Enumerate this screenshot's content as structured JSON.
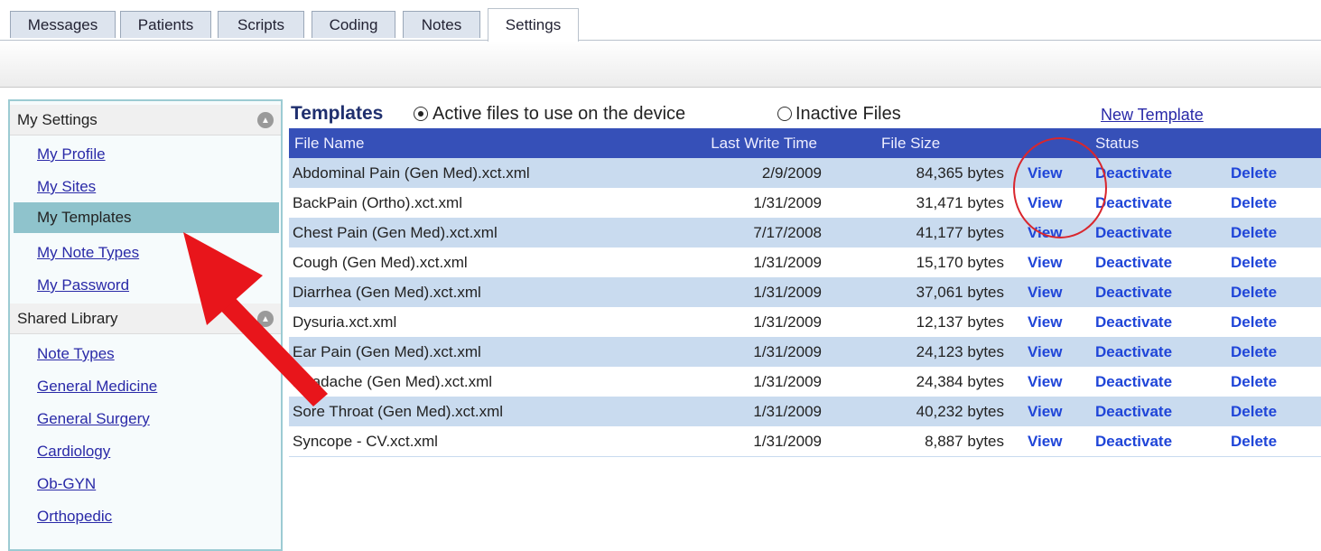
{
  "tabs": [
    {
      "label": "Messages"
    },
    {
      "label": "Patients"
    },
    {
      "label": "Scripts"
    },
    {
      "label": "Coding"
    },
    {
      "label": "Notes"
    },
    {
      "label": "Settings",
      "active": true
    }
  ],
  "sidebar": {
    "my_settings": {
      "title": "My Settings",
      "items": [
        {
          "label": "My Profile"
        },
        {
          "label": "My Sites"
        },
        {
          "label": "My Templates",
          "selected": true
        },
        {
          "label": "My Note Types"
        },
        {
          "label": "My Password"
        }
      ]
    },
    "shared_library": {
      "title": "Shared Library",
      "items": [
        {
          "label": "Note Types"
        },
        {
          "label": "General Medicine"
        },
        {
          "label": "General  Surgery"
        },
        {
          "label": "Cardiology"
        },
        {
          "label": "Ob-GYN"
        },
        {
          "label": "Orthopedic"
        }
      ]
    }
  },
  "main": {
    "title": "Templates",
    "radio_active": "Active files to use on the device",
    "radio_inactive": "Inactive Files",
    "new_template": "New Template",
    "columns": {
      "name": "File Name",
      "date": "Last Write Time",
      "size": "File Size",
      "status": "Status"
    },
    "actions": {
      "view": "View",
      "deactivate": "Deactivate",
      "delete": "Delete"
    },
    "rows": [
      {
        "name": "Abdominal Pain (Gen Med).xct.xml",
        "date": "2/9/2009",
        "size": "84,365 bytes"
      },
      {
        "name": "BackPain (Ortho).xct.xml",
        "date": "1/31/2009",
        "size": "31,471 bytes"
      },
      {
        "name": "Chest Pain (Gen Med).xct.xml",
        "date": "7/17/2008",
        "size": "41,177 bytes"
      },
      {
        "name": "Cough (Gen Med).xct.xml",
        "date": "1/31/2009",
        "size": "15,170 bytes"
      },
      {
        "name": "Diarrhea (Gen Med).xct.xml",
        "date": "1/31/2009",
        "size": "37,061 bytes"
      },
      {
        "name": "Dysuria.xct.xml",
        "date": "1/31/2009",
        "size": "12,137 bytes"
      },
      {
        "name": "Ear Pain (Gen Med).xct.xml",
        "date": "1/31/2009",
        "size": "24,123 bytes"
      },
      {
        "name": "Headache (Gen Med).xct.xml",
        "date": "1/31/2009",
        "size": "24,384 bytes"
      },
      {
        "name": "Sore Throat (Gen Med).xct.xml",
        "date": "1/31/2009",
        "size": "40,232 bytes"
      },
      {
        "name": "Syncope - CV.xct.xml",
        "date": "1/31/2009",
        "size": "8,887 bytes"
      }
    ]
  },
  "annotations": {
    "color": "#e8151b"
  }
}
